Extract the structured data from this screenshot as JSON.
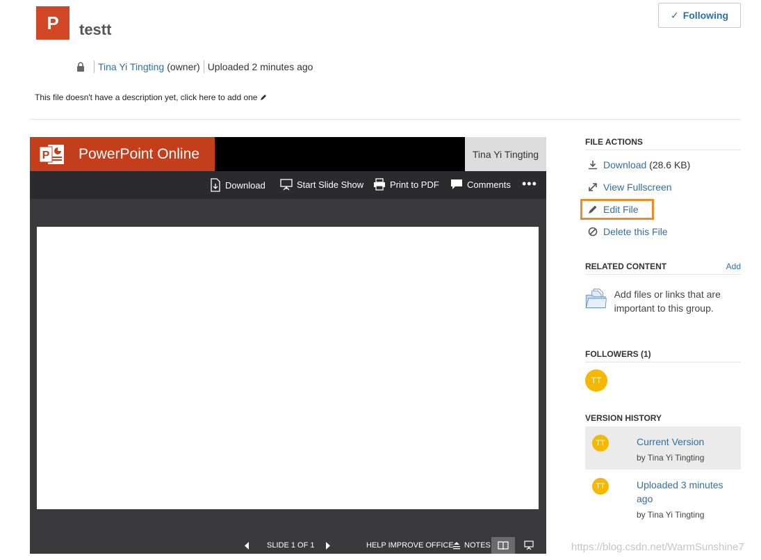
{
  "file": {
    "icon_letter": "P",
    "title": "testt",
    "follow_label": "Following",
    "owner_name": "Tina Yi Tingting",
    "owner_role": "(owner)",
    "uploaded": "Uploaded 2 minutes ago",
    "description_prompt": "This file doesn't have a description yet, click here to add one"
  },
  "viewer": {
    "app_name": "PowerPoint Online",
    "user": "Tina Yi Tingting",
    "toolbar": {
      "download": "Download",
      "slideshow": "Start Slide Show",
      "print": "Print to PDF",
      "comments": "Comments",
      "more": "•••"
    },
    "status": {
      "slide": "SLIDE 1 OF 1",
      "help": "HELP IMPROVE OFFICE",
      "notes": "NOTES"
    }
  },
  "sidebar": {
    "file_actions_header": "FILE ACTIONS",
    "download_label": "Download",
    "download_size": "(28.6 KB)",
    "fullscreen_label": "View Fullscreen",
    "edit_label": "Edit File",
    "delete_label": "Delete this File",
    "related_header": "RELATED CONTENT",
    "related_add": "Add",
    "related_text": "Add files or links that are important to this group.",
    "followers_header": "FOLLOWERS (1)",
    "follower_initials": "TT",
    "version_header": "VERSION HISTORY",
    "versions": [
      {
        "initials": "TT",
        "title": "Current Version",
        "by": "by Tina Yi Tingting"
      },
      {
        "initials": "TT",
        "title": "Uploaded 3 minutes ago",
        "by": "by Tina Yi Tingting"
      }
    ]
  },
  "watermark": "https://blog.csdn.net/WarmSunshine7",
  "colors": {
    "ppt_brand": "#c43e1c",
    "file_icon": "#d24726",
    "link": "#2f6fa8",
    "highlight": "#f08a24",
    "avatar": "#f5b800"
  }
}
